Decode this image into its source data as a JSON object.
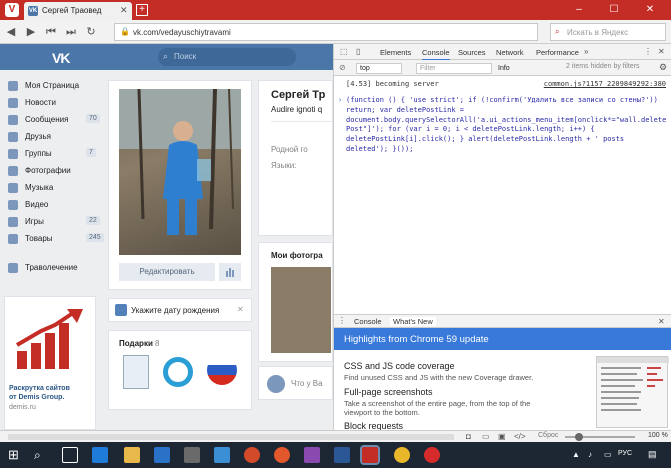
{
  "browser": {
    "logo": "V",
    "tab_title": "Сергей Траовед",
    "tab_favicon": "VK",
    "url": "vk.com/vedayuschiytravami",
    "search_placeholder": "Искать в Яндекс",
    "accent": "#c42c26"
  },
  "vk": {
    "search_placeholder": "Поиск",
    "menu": [
      {
        "label": "Моя Страница",
        "count": ""
      },
      {
        "label": "Новости",
        "count": ""
      },
      {
        "label": "Сообщения",
        "count": "70"
      },
      {
        "label": "Друзья",
        "count": ""
      },
      {
        "label": "Группы",
        "count": "7"
      },
      {
        "label": "Фотографии",
        "count": ""
      },
      {
        "label": "Музыка",
        "count": ""
      },
      {
        "label": "Видео",
        "count": ""
      },
      {
        "label": "Игры",
        "count": "22"
      },
      {
        "label": "Товары",
        "count": "245"
      },
      {
        "label": "Траволечение",
        "count": ""
      }
    ],
    "ad": {
      "line1": "Раскрутка сайтов",
      "line2": "от Demis Group.",
      "line3": "demis.ru"
    },
    "edit_button": "Редактировать",
    "birthday_prompt": "Укажите дату рождения",
    "gifts_title": "Подарки",
    "gifts_count": "8",
    "profile_name": "Сергей Тр",
    "profile_status": "Audire ignoti q",
    "home_city_label": "Родной го",
    "languages_label": "Языки:",
    "photos_title": "Мои фотогра",
    "post_placeholder": "Что у Ва"
  },
  "devtools": {
    "tabs": [
      "Elements",
      "Console",
      "Sources",
      "Network",
      "Performance"
    ],
    "active_tab": "Console",
    "context": "top",
    "filter_placeholder": "Filter",
    "level": "Info",
    "hidden_text": "2 items hidden by filters",
    "log_text": "[4.53]  becoming server",
    "log_source": "common.js?1157_2209849292:380",
    "code": "(function () { 'use strict'; if (!confirm('Удалить все записи со стены?')) return; var deletePostLink = document.body.querySelectorAll('a.ui_actions_menu_item[onclick*=\"wall.delete Post\"]'); for (var i = 0; i < deletePostLink.length; i++) { deletePostLink[i].click(); } alert(deletePostLink.length + ' posts deleted'); }());",
    "drawer_tabs": [
      "Console",
      "What's New"
    ],
    "whatsnew_title": "Highlights from Chrome 59 update",
    "whatsnew_items": [
      {
        "head": "CSS and JS code coverage",
        "body": "Find unused CSS and JS with the new Coverage drawer."
      },
      {
        "head": "Full-page screenshots",
        "body": "Take a screenshot of the entire page, from the top of the viewport to the bottom."
      },
      {
        "head": "Block requests",
        "body": ""
      }
    ]
  },
  "statusbar": {
    "reset": "Сброс",
    "zoom": "100 %"
  },
  "taskbar": {
    "lang": "РУС"
  }
}
